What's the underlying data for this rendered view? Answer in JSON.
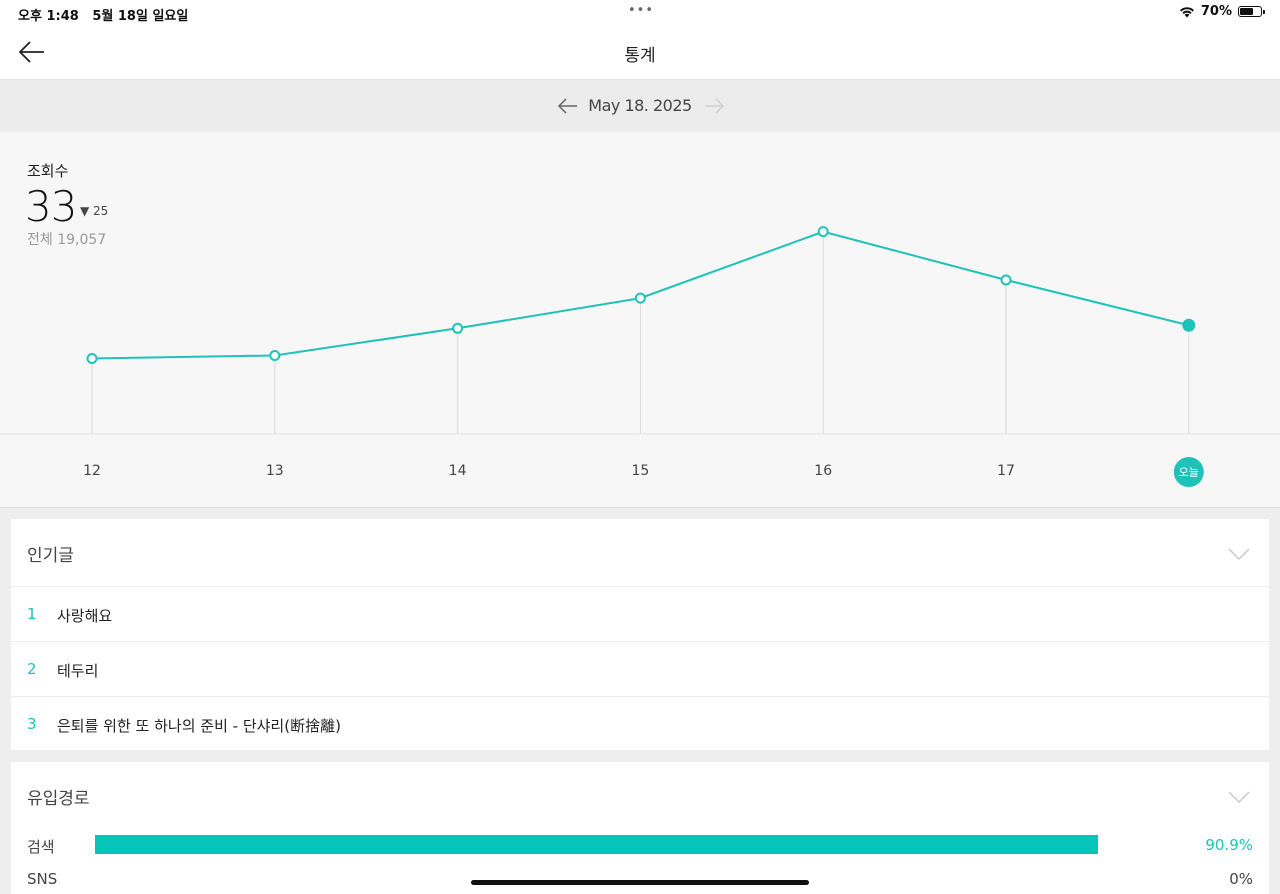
{
  "status_bar": {
    "time": "오후 1:48",
    "date": "5월 18일 일요일",
    "dots": "•••",
    "battery": "70%",
    "battery_level": 0.7
  },
  "header": {
    "title": "통계",
    "back_icon": "arrow-left-icon"
  },
  "date_nav": {
    "date": "May 18. 2025",
    "prev_icon": "arrow-left-icon",
    "next_icon": "arrow-right-icon"
  },
  "summary": {
    "label": "조회수",
    "value": "33",
    "change": "▼ 25",
    "total": "전체 19,057"
  },
  "chart_data": {
    "type": "line",
    "categories": [
      "12",
      "13",
      "14",
      "15",
      "16",
      "17",
      "오늘"
    ],
    "values": [
      25,
      26,
      35,
      45,
      67,
      51,
      36
    ],
    "ylim": [
      0,
      100
    ],
    "grid": false,
    "highlight_last": true
  },
  "popular_posts": {
    "title": "인기글",
    "items": [
      {
        "rank": "1",
        "title": "사랑해요"
      },
      {
        "rank": "2",
        "title": "테두리"
      },
      {
        "rank": "3",
        "title": "은퇴를 위한 또 하나의 준비 - 단샤리(断捨離)"
      }
    ]
  },
  "referrers": {
    "title": "유입경로",
    "items": [
      {
        "label": "검색",
        "percent": "90.9%",
        "fraction": 0.909
      },
      {
        "label": "SNS",
        "percent": "0%",
        "fraction": 0
      }
    ]
  },
  "colors": {
    "accent": "#1ec2b8",
    "bar": "#07c4b9"
  }
}
